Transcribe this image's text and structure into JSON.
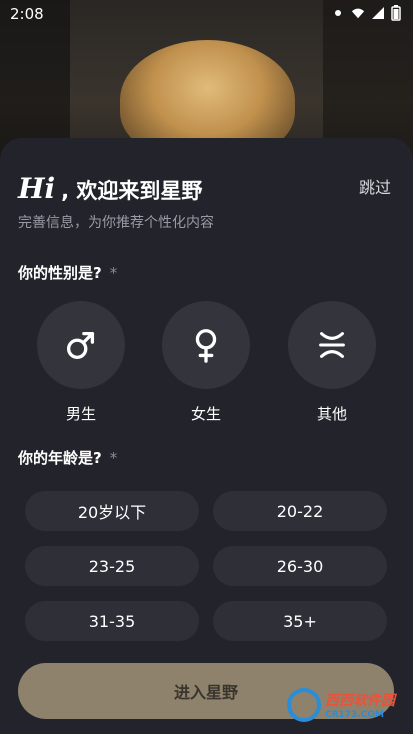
{
  "status_bar": {
    "time": "2:08"
  },
  "header": {
    "hi": "Hi",
    "title": ", 欢迎来到星野",
    "skip_label": "跳过",
    "subtitle": "完善信息，为你推荐个性化内容"
  },
  "gender_section": {
    "question": "你的性别是?",
    "required_mark": "*",
    "options": [
      {
        "label": "男生",
        "icon": "male-symbol-icon"
      },
      {
        "label": "女生",
        "icon": "female-symbol-icon"
      },
      {
        "label": "其他",
        "icon": "other-gender-icon"
      }
    ]
  },
  "age_section": {
    "question": "你的年龄是?",
    "required_mark": "*",
    "options": [
      "20岁以下",
      "20-22",
      "23-25",
      "26-30",
      "31-35",
      "35+"
    ]
  },
  "footer": {
    "enter_label": "进入星野",
    "watermark_brand": "西西软件园",
    "watermark_sub": "CR173.COM"
  },
  "colors": {
    "sheet_bg": "#23232b",
    "option_bg": "#34343d",
    "enter_button": "#8e826c"
  }
}
